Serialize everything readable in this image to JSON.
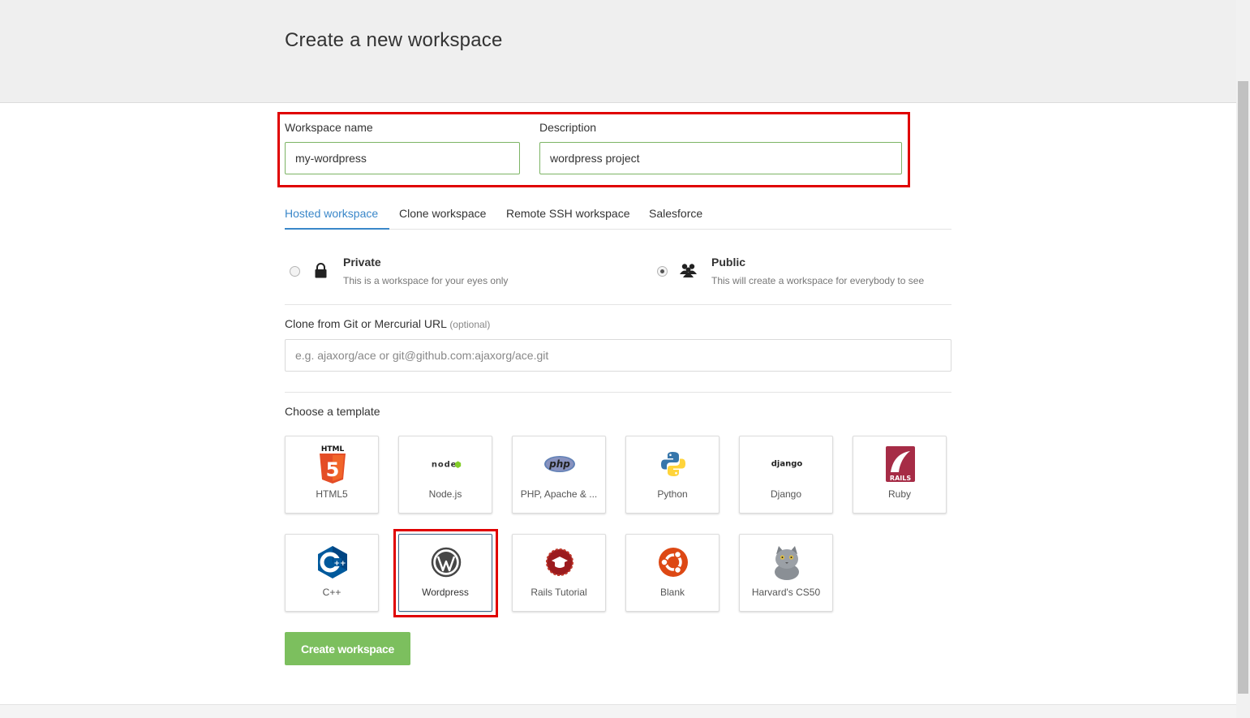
{
  "page": {
    "title": "Create a new workspace"
  },
  "form": {
    "name_label": "Workspace name",
    "name_value": "my-wordpress",
    "description_label": "Description",
    "description_value": "wordpress project"
  },
  "tabs": [
    {
      "label": "Hosted workspace",
      "active": true
    },
    {
      "label": "Clone workspace",
      "active": false
    },
    {
      "label": "Remote SSH workspace",
      "active": false
    },
    {
      "label": "Salesforce",
      "active": false
    }
  ],
  "privacy": {
    "private": {
      "title": "Private",
      "desc": "This is a workspace for your eyes only",
      "icon": "lock-icon",
      "selected": false
    },
    "public": {
      "title": "Public",
      "desc": "This will create a workspace for everybody to see",
      "icon": "users-icon",
      "selected": true
    }
  },
  "clone": {
    "label": "Clone from Git or Mercurial URL",
    "optional": "(optional)",
    "placeholder": "e.g. ajaxorg/ace or git@github.com:ajaxorg/ace.git"
  },
  "templates": {
    "heading": "Choose a template",
    "items": [
      {
        "label": "HTML5",
        "icon": "html5-icon"
      },
      {
        "label": "Node.js",
        "icon": "nodejs-icon"
      },
      {
        "label": "PHP, Apache & ...",
        "icon": "php-icon"
      },
      {
        "label": "Python",
        "icon": "python-icon"
      },
      {
        "label": "Django",
        "icon": "django-icon"
      },
      {
        "label": "Ruby",
        "icon": "rails-icon"
      },
      {
        "label": "C++",
        "icon": "cpp-icon"
      },
      {
        "label": "Wordpress",
        "icon": "wordpress-icon",
        "selected": true
      },
      {
        "label": "Rails Tutorial",
        "icon": "rails-tutorial-icon"
      },
      {
        "label": "Blank",
        "icon": "ubuntu-icon"
      },
      {
        "label": "Harvard's CS50",
        "icon": "cat-icon"
      }
    ]
  },
  "logo_text": {
    "html": "HTML",
    "html5": "5",
    "node": "node",
    "php": "php",
    "django": "django",
    "rails": "RAILS"
  },
  "actions": {
    "create_label": "Create workspace"
  },
  "colors": {
    "accent_tab": "#3a87c9",
    "primary_button": "#7cbf5e",
    "input_border_valid": "#7db465",
    "annotation_red": "#e00000"
  }
}
